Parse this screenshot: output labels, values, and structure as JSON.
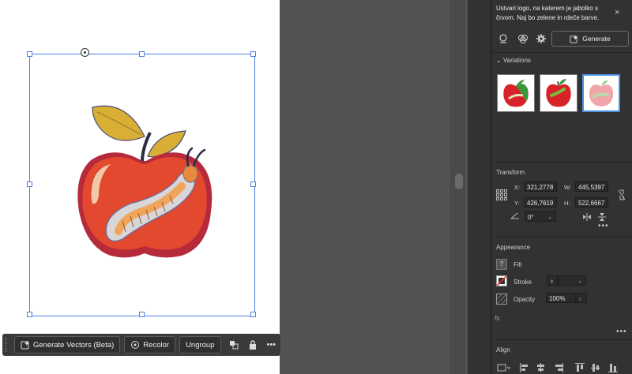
{
  "context_toolbar": {
    "generate_vectors": "Generate Vectors (Beta)",
    "recolor": "Recolor",
    "ungroup": "Ungroup",
    "more": "•••"
  },
  "prompt_panel": {
    "prompt_text": "Ustvari logo, na katerem je jabolko s črvom. Naj bo zelene in rdeče barve.",
    "close": "×",
    "generate_label": "Generate"
  },
  "variations": {
    "header": "Variations",
    "chevron": "⌄"
  },
  "transform": {
    "header": "Transform",
    "x_label": "X:",
    "x_value": "321,2778",
    "y_label": "Y:",
    "y_value": "426,7619",
    "w_label": "W:",
    "w_value": "445,5397",
    "h_label": "H:",
    "h_value": "522,6667",
    "angle_value": "0°",
    "more": "•••"
  },
  "appearance": {
    "header": "Appearance",
    "fill_label": "Fill",
    "fill_marker": "?",
    "stroke_label": "Stroke",
    "opacity_label": "Opacity",
    "opacity_value": "100%",
    "fx": "fx.",
    "more": "•••"
  },
  "align": {
    "header": "Align"
  },
  "colors": {
    "accent": "#4a7fe8",
    "apple_red": "#e2492e",
    "leaf_yellow": "#d9b035",
    "worm_orange": "#e98a3c"
  }
}
